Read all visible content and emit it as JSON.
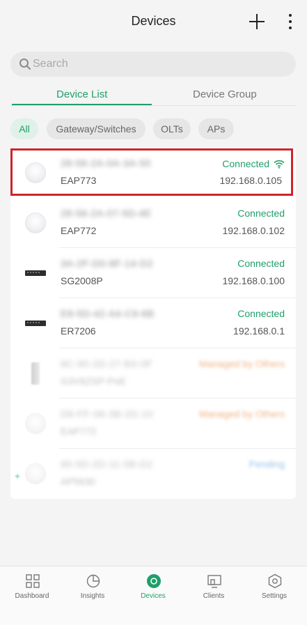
{
  "header": {
    "title": "Devices",
    "add_icon": "plus-icon",
    "more_icon": "more-vertical-icon"
  },
  "search": {
    "placeholder": "Search",
    "icon": "search-icon"
  },
  "tabs": [
    {
      "label": "Device List",
      "active": true
    },
    {
      "label": "Device Group",
      "active": false
    }
  ],
  "filters": [
    {
      "label": "All",
      "active": true
    },
    {
      "label": "Gateway/Switches",
      "active": false
    },
    {
      "label": "OLTs",
      "active": false
    },
    {
      "label": "APs",
      "active": false
    }
  ],
  "devices": [
    {
      "mac": "28-56-2A-0A-3A-50",
      "model": "EAP773",
      "status": "Connected",
      "ip": "192.168.0.105",
      "icon": "access-point-icon",
      "wifi_icon": "wifi-icon"
    },
    {
      "mac": "28-56-2A-07-5D-4E",
      "model": "EAP772",
      "status": "Connected",
      "ip": "192.168.0.102",
      "icon": "access-point-icon"
    },
    {
      "mac": "3A-2F-D0-8F-14-D2",
      "model": "SG2008P",
      "status": "Connected",
      "ip": "192.168.0.100",
      "icon": "switch-icon"
    },
    {
      "mac": "E8-5D-42-A4-C9-6B",
      "model": "ER7206",
      "status": "Connected",
      "ip": "192.168.0.1",
      "icon": "router-icon"
    },
    {
      "mac": "8C-90-2D-27-B4-0F",
      "model": "G3V6ZSP-PoE",
      "status": "Managed by Others",
      "icon": "device-icon"
    },
    {
      "mac": "D8-FF-06-3B-2D-10",
      "model": "EAP772",
      "status": "Managed by Others",
      "icon": "access-point-icon"
    },
    {
      "mac": "90-5D-2D-11-5B-D2",
      "model": "AP5630",
      "status": "Pending",
      "icon": "access-point-icon"
    }
  ],
  "bottom_nav": [
    {
      "label": "Dashboard",
      "icon": "dashboard-icon",
      "active": false
    },
    {
      "label": "Insights",
      "icon": "insights-icon",
      "active": false
    },
    {
      "label": "Devices",
      "icon": "devices-icon",
      "active": true
    },
    {
      "label": "Clients",
      "icon": "clients-icon",
      "active": false
    },
    {
      "label": "Settings",
      "icon": "settings-icon",
      "active": false
    }
  ],
  "colors": {
    "accent": "#1f9f6a",
    "highlight": "#d0232a",
    "managed": "#efb283",
    "pending": "#93c3ea"
  }
}
